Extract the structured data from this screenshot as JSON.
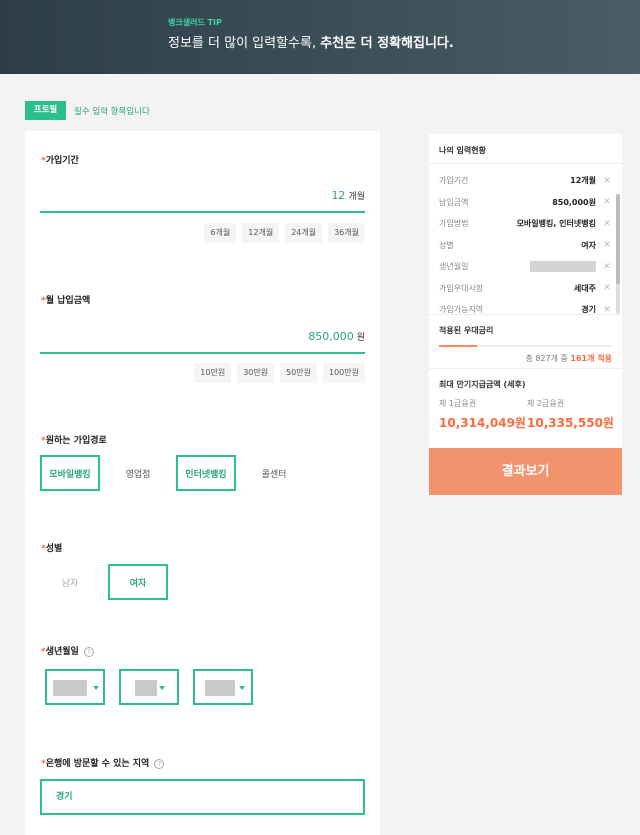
{
  "banner": {
    "tip": "뱅크샐러드 TIP",
    "msg_normal": "정보를 더 많이 입력할수록, ",
    "msg_bold": "추천은 더 정확해집니다."
  },
  "profile": {
    "badge": "프로필",
    "note": "필수 입력 항목입니다"
  },
  "form": {
    "required_mark": "*",
    "period": {
      "label": "가입기간",
      "value": "12",
      "unit": "개월",
      "chips": [
        "6개월",
        "12개월",
        "24개월",
        "36개월"
      ]
    },
    "monthly": {
      "label": "월 납입금액",
      "value": "850,000",
      "unit": "원",
      "chips": [
        "10만원",
        "30만원",
        "50만원",
        "100만원"
      ]
    },
    "channel": {
      "label": "원하는 가입경로",
      "options": [
        {
          "label": "모바일뱅킹",
          "selected": true
        },
        {
          "label": "영업점",
          "selected": false
        },
        {
          "label": "인터넷뱅킹",
          "selected": true
        },
        {
          "label": "콜센터",
          "selected": false
        }
      ]
    },
    "gender": {
      "label": "성별",
      "options": [
        {
          "label": "남자",
          "selected": false
        },
        {
          "label": "여자",
          "selected": true
        }
      ]
    },
    "birth": {
      "label": "생년월일",
      "help": "?"
    },
    "region": {
      "label": "은행에 방문할 수 있는 지역",
      "help": "?",
      "value": "경기"
    }
  },
  "summary": {
    "title": "나의 입력현황",
    "rows": [
      {
        "key": "가입기간",
        "value": "12개월"
      },
      {
        "key": "납입금액",
        "value": "850,000원"
      },
      {
        "key": "가입방법",
        "value": "모바일뱅킹, 인터넷뱅킹"
      },
      {
        "key": "성별",
        "value": "여자"
      },
      {
        "key": "생년월일",
        "value": ""
      },
      {
        "key": "가입우대사항",
        "value": "세대주"
      },
      {
        "key": "가입가능지역",
        "value": "경기"
      }
    ],
    "remove_icon": "✕"
  },
  "rate": {
    "title": "적용된 우대금리",
    "progress": 0.22,
    "count_prefix": "총 827개 중 ",
    "count_highlight": "161개 적용"
  },
  "amount": {
    "title": "최대 만기지급금액 (세후)",
    "items": [
      {
        "label": "제 1금융권",
        "value": "10,314,049원"
      },
      {
        "label": "제 2금융권",
        "value": "10,335,550원"
      }
    ]
  },
  "result_button": "결과보기",
  "colors": {
    "accent": "#2bbf8e",
    "highlight": "#ff6a3d",
    "result_button": "#f2936d"
  }
}
